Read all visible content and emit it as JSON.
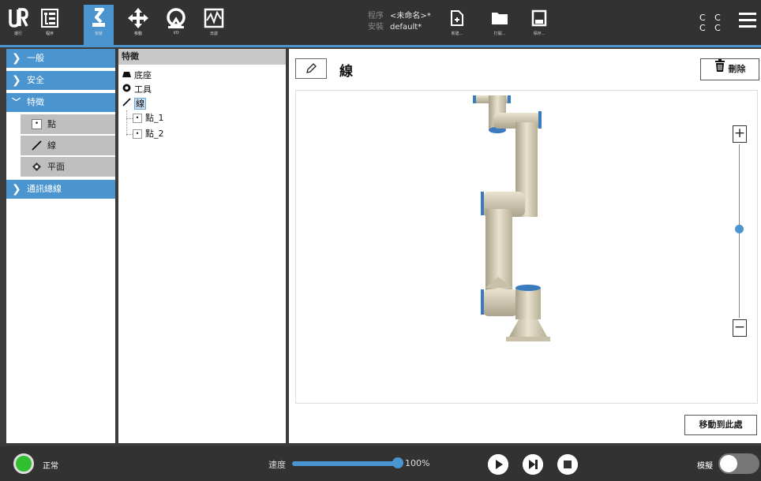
{
  "header": {
    "nav": [
      {
        "label": "運行",
        "icon": "ur-logo-icon"
      },
      {
        "label": "程序",
        "icon": "program-icon"
      },
      {
        "label": "安裝",
        "icon": "installation-icon"
      },
      {
        "label": "移動",
        "icon": "move-icon"
      },
      {
        "label": "I/O",
        "icon": "io-icon"
      },
      {
        "label": "日誌",
        "icon": "log-icon"
      }
    ],
    "program_key": "程序",
    "program_value": "<未命名>*",
    "installation_key": "安裝",
    "installation_value": "default*",
    "file_buttons": [
      {
        "label": "新建...",
        "icon": "new-file-icon"
      },
      {
        "label": "打開...",
        "icon": "open-folder-icon"
      },
      {
        "label": "保存...",
        "icon": "save-icon"
      }
    ],
    "cc_line1": "C C",
    "cc_line2": "C C"
  },
  "menu": {
    "items": [
      "一般",
      "安全",
      "特徵",
      "通訊總線"
    ],
    "sub_items": [
      "點",
      "線",
      "平面"
    ]
  },
  "tree": {
    "header": "特徵",
    "nodes": [
      "底座",
      "工具",
      "線",
      "點_1",
      "點_2"
    ]
  },
  "main": {
    "title": "線",
    "delete_label": "刪除",
    "zoom_in": "+",
    "zoom_out": "−",
    "move_here_label": "移動到此處"
  },
  "footer": {
    "status": "正常",
    "speed_label": "速度",
    "speed_value": "100%",
    "speed_fraction": 1.0,
    "simulation_label": "模擬",
    "simulation_on": false
  },
  "colors": {
    "accent": "#4a94cf",
    "header_bg": "#323232",
    "status_ok": "#2fbf2f"
  }
}
